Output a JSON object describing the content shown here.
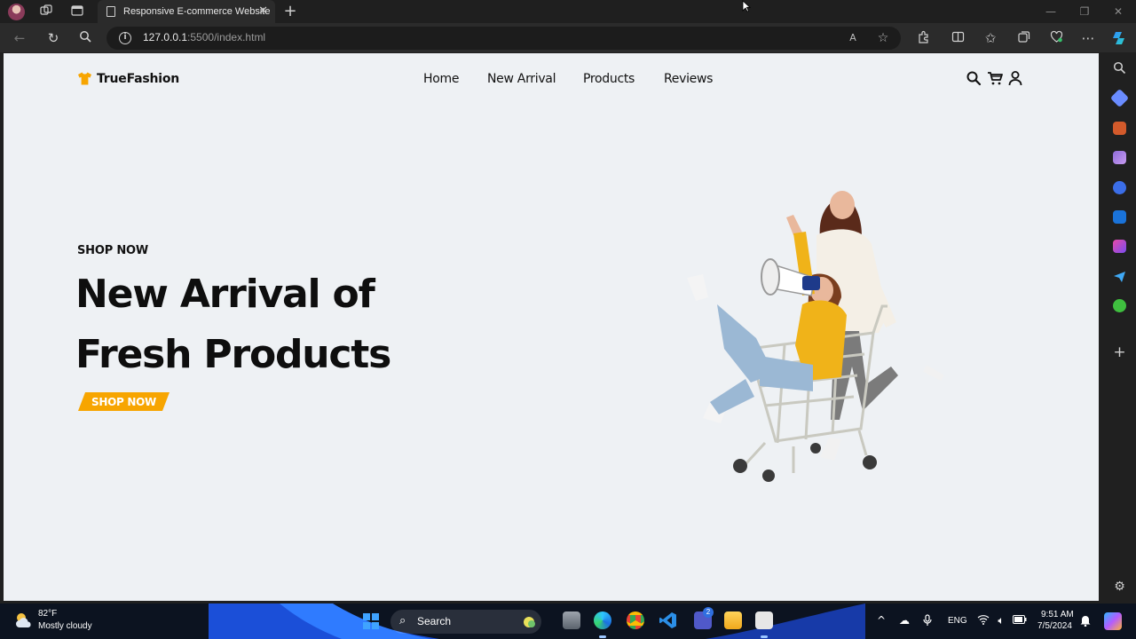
{
  "browser": {
    "tab_title": "Responsive E-commerce Website",
    "tab_close": "✕",
    "new_tab": "+",
    "url_host": "127.0.0.1",
    "url_path": ":5500/index.html"
  },
  "site": {
    "logo_text": "TrueFashion",
    "menu": [
      {
        "label": "Home"
      },
      {
        "label": "New Arrival"
      },
      {
        "label": "Products"
      },
      {
        "label": "Reviews"
      }
    ],
    "header_icons": [
      "search-icon",
      "cart-icon",
      "user-icon"
    ],
    "accent_color": "#f7a500",
    "hero": {
      "eyebrow": "SHOP NOW",
      "title_line1": "New Arrival of",
      "title_line2": "Fresh Products",
      "button_label": "SHOP NOW"
    }
  },
  "taskbar": {
    "weather_temp": "82°F",
    "weather_condition": "Mostly cloudy",
    "search_label": "Search",
    "language": "ENG",
    "time": "9:51 AM",
    "date": "7/5/2024",
    "teams_badge": "2"
  }
}
